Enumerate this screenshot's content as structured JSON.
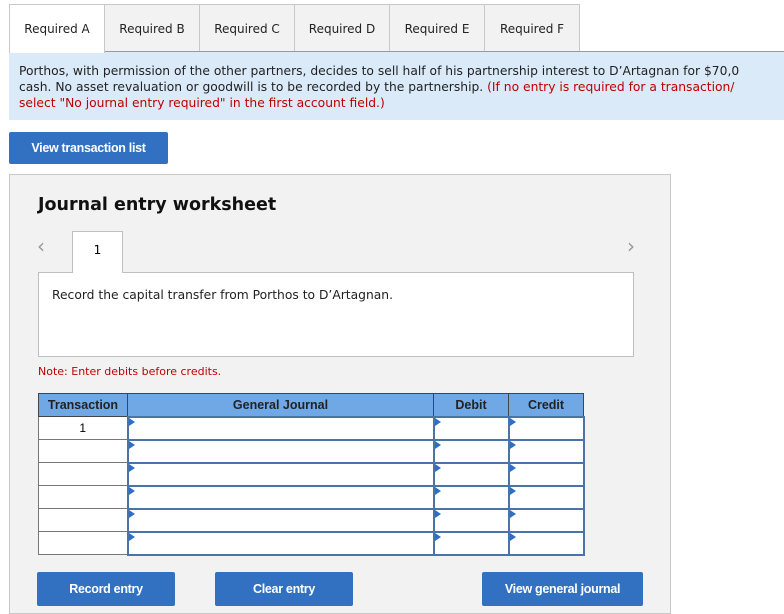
{
  "tabs": [
    {
      "label": "Required A",
      "active": true
    },
    {
      "label": "Required B",
      "active": false
    },
    {
      "label": "Required C",
      "active": false
    },
    {
      "label": "Required D",
      "active": false
    },
    {
      "label": "Required E",
      "active": false
    },
    {
      "label": "Required F",
      "active": false
    }
  ],
  "question": {
    "line1": "Porthos, with permission of the other partners, decides to sell half of his partnership interest to D’Artagnan for $70,0",
    "line2_black": "cash. No asset revaluation or goodwill is to be recorded by the partnership. ",
    "line2_red": "(If no entry is required for a transaction/",
    "line3_red": "select \"No journal entry required\" in the first account field.)"
  },
  "buttons": {
    "view_transaction_list": "View transaction list",
    "record_entry": "Record entry",
    "clear_entry": "Clear entry",
    "view_general_journal": "View general journal"
  },
  "worksheet": {
    "title": "Journal entry worksheet",
    "current_step": "1",
    "description": "Record the capital transfer from Porthos to D’Artagnan.",
    "note": "Note: Enter debits before credits."
  },
  "table": {
    "headers": [
      "Transaction",
      "General Journal",
      "Debit",
      "Credit"
    ],
    "rows": [
      {
        "transaction": "1",
        "account": "",
        "debit": "",
        "credit": ""
      },
      {
        "transaction": "",
        "account": "",
        "debit": "",
        "credit": ""
      },
      {
        "transaction": "",
        "account": "",
        "debit": "",
        "credit": ""
      },
      {
        "transaction": "",
        "account": "",
        "debit": "",
        "credit": ""
      },
      {
        "transaction": "",
        "account": "",
        "debit": "",
        "credit": ""
      },
      {
        "transaction": "",
        "account": "",
        "debit": "",
        "credit": ""
      }
    ]
  },
  "icons": {
    "prev": "chevron-left-icon",
    "next": "chevron-right-icon"
  }
}
